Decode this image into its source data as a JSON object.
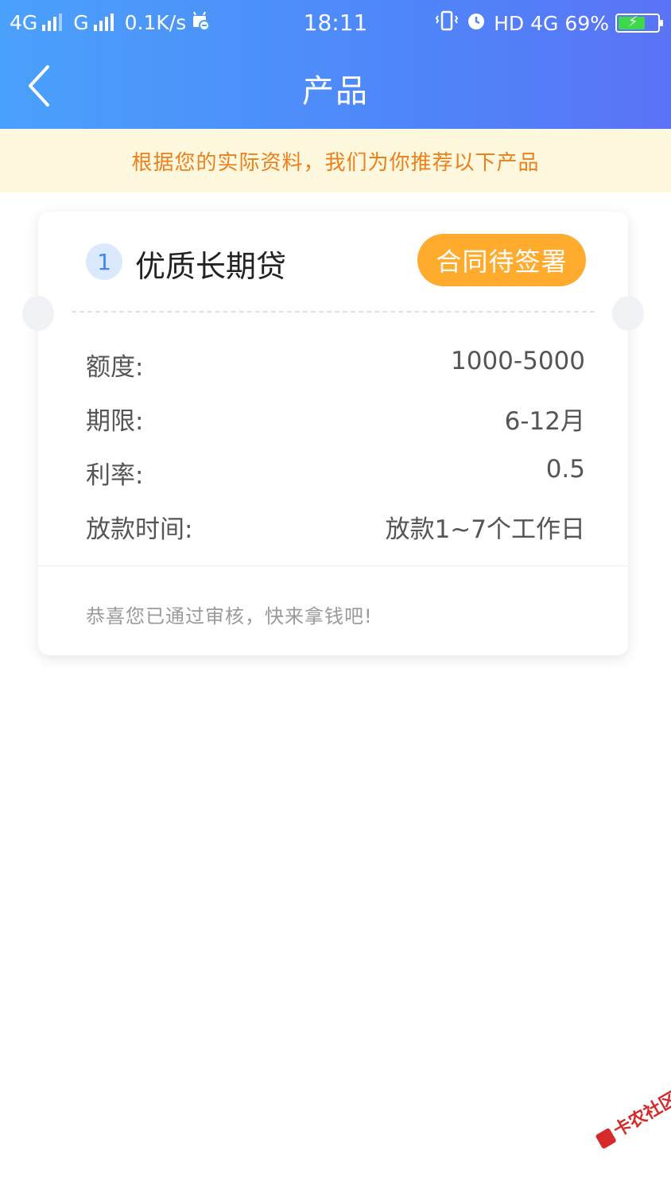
{
  "status_bar": {
    "network1": "4G",
    "network2": "G",
    "speed": "0.1K/s",
    "time": "18:11",
    "hd": "HD",
    "network3": "4G",
    "battery_percent": "69%",
    "battery_level": 0.69
  },
  "nav": {
    "title": "产品",
    "back_icon": "chevron-left-icon"
  },
  "notice": {
    "text": "根据您的实际资料，我们为你推荐以下产品"
  },
  "product": {
    "index": "1",
    "name": "优质长期贷",
    "button_label": "合同待签署",
    "rows": [
      {
        "label": "额度:",
        "value": "1000-5000"
      },
      {
        "label": "期限:",
        "value": "6-12月"
      },
      {
        "label": "利率:",
        "value": "0.5"
      },
      {
        "label": "放款时间:",
        "value": "放款1~7个工作日"
      }
    ],
    "footer": "恭喜您已通过审核，快来拿钱吧!"
  },
  "watermark": {
    "text": "卡农社区"
  },
  "colors": {
    "header_gradient_start": "#4aa1fb",
    "header_gradient_end": "#5a73f6",
    "notice_bg": "#fef8df",
    "notice_text": "#ef7f1a",
    "button_bg": "#ffab2d",
    "badge_bg": "#dbe9fd",
    "badge_text": "#3f84f0"
  }
}
